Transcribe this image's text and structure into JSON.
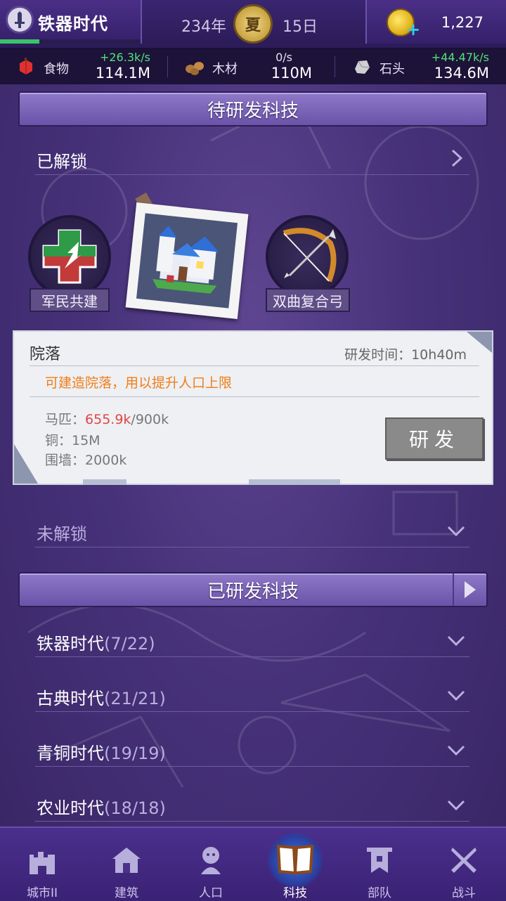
{
  "header": {
    "era_name": "铁器时代",
    "year": "234年",
    "season": "夏",
    "day": "15日",
    "era_progress": 0.28,
    "gems": "1,227"
  },
  "resources": [
    {
      "name": "食物",
      "rate": "+26.3k/s",
      "total": "114.1M",
      "icon": "food-icon"
    },
    {
      "name": "木材",
      "rate": "0/s",
      "total": "110M",
      "icon": "wood-icon"
    },
    {
      "name": "石头",
      "rate": "+44.47k/s",
      "total": "134.6M",
      "icon": "stone-icon"
    }
  ],
  "pending": {
    "header": "待研发科技",
    "unlocked_label": "已解锁",
    "techs": [
      {
        "label": "军民共建",
        "icon": "medical-cross-icon"
      },
      {
        "label": "",
        "icon": "courtyard-castle-icon"
      },
      {
        "label": "双曲复合弓",
        "icon": "recurve-bow-icon"
      }
    ],
    "locked_label": "未解锁"
  },
  "detail": {
    "title": "院落",
    "time_label": "研发时间：10h40m",
    "description": "可建造院落，用以提升人口上限",
    "costs": {
      "horse_label": "马匹：",
      "horse_have": "655.9k",
      "horse_need": "/900k",
      "copper": "铜：15M",
      "wall": "围墙：2000k"
    },
    "button": "研发"
  },
  "researched": {
    "header": "已研发科技",
    "eras": [
      {
        "name": "铁器时代",
        "count": "(7/22)"
      },
      {
        "name": "古典时代",
        "count": "(21/21)"
      },
      {
        "name": "青铜时代",
        "count": "(19/19)"
      },
      {
        "name": "农业时代",
        "count": "(18/18)"
      }
    ]
  },
  "nav": [
    {
      "label": "城市II",
      "icon": "castle-icon"
    },
    {
      "label": "建筑",
      "icon": "house-icon"
    },
    {
      "label": "人口",
      "icon": "person-icon"
    },
    {
      "label": "科技",
      "icon": "book-icon",
      "active": true
    },
    {
      "label": "部队",
      "icon": "banner-icon"
    },
    {
      "label": "战斗",
      "icon": "crossed-swords-icon"
    }
  ],
  "colors": {
    "background": "#47327a",
    "accent_green": "#4fe37a",
    "cost_red": "#e04545",
    "desc_orange": "#f07d17"
  }
}
